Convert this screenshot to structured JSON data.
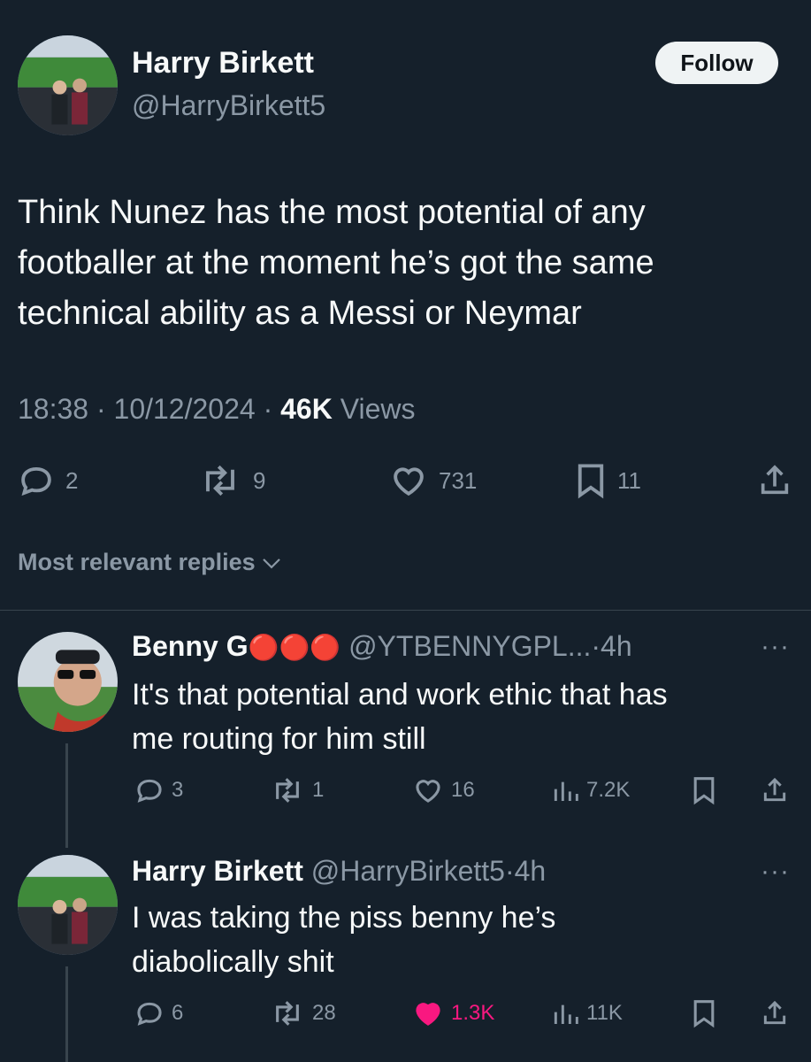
{
  "main_tweet": {
    "author_name": "Harry Birkett",
    "handle": "@HarryBirkett5",
    "follow_label": "Follow",
    "text_lines": [
      "Think Nunez has the most potential of any",
      "footballer at the moment he’s got the same",
      "technical ability as a Messi or Neymar"
    ],
    "time": "18:38",
    "date": "10/12/2024",
    "views_count": "46K",
    "views_label": "Views",
    "sep": "·",
    "replies": "2",
    "retweets": "9",
    "likes": "731",
    "bookmarks": "11"
  },
  "sort": {
    "label": "Most relevant replies"
  },
  "replies": [
    {
      "author_name": "Benny G",
      "badges": "🔴🔴🔴",
      "handle": "@YTBENNYGPL...",
      "sep": "·",
      "time": "4h",
      "text_lines": [
        "It's that potential and work ethic that has",
        "me routing for him still"
      ],
      "replies": "3",
      "retweets": "1",
      "likes": "16",
      "views": "7.2K",
      "liked": false
    },
    {
      "author_name": "Harry Birkett",
      "handle": "@HarryBirkett5",
      "sep": "·",
      "time": "4h",
      "text_lines": [
        "I was taking the piss benny he’s",
        "diabolically shit"
      ],
      "replies": "6",
      "retweets": "28",
      "likes": "1.3K",
      "views": "11K",
      "liked": true
    }
  ],
  "colors": {
    "background": "#15202b",
    "muted": "#8b98a5",
    "like_active": "#f91880",
    "divider": "#38444d"
  }
}
